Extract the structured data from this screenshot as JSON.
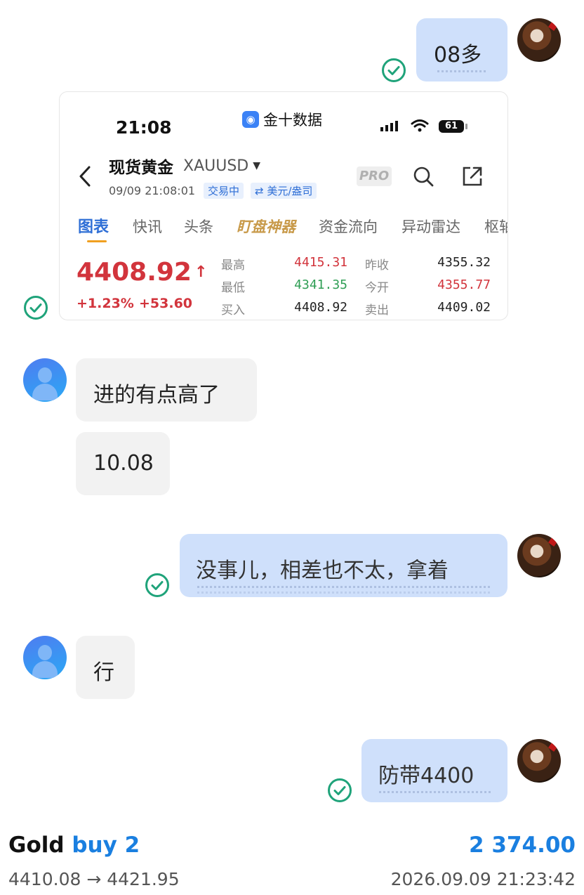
{
  "messages": {
    "m1": "08多",
    "m2": "进的有点高了",
    "m3": "10.08",
    "m4": "没事儿，相差也不太，拿着",
    "m5": "行",
    "m6": "防带4400"
  },
  "shot": {
    "time": "21:08",
    "app_name": "金十数据",
    "battery": "61",
    "instrument": "现货黄金",
    "symbol": "XAUUSD",
    "datetime": "09/09 21:08:01",
    "tag_trading": "交易中",
    "tag_currency": "⇄ 美元/盎司",
    "pro_badge": "PRO",
    "tabs": [
      "图表",
      "快讯",
      "头条",
      "盯盘神器",
      "资金流向",
      "异动雷达",
      "枢轴"
    ],
    "price": "4408.92",
    "change_pct": "+1.23%",
    "change_abs": "+53.60",
    "stats": {
      "high_label": "最高",
      "high": "4415.31",
      "low_label": "最低",
      "low": "4341.35",
      "buy_label": "买入",
      "buy": "4408.92",
      "prev_close_label": "昨收",
      "prev_close": "4355.32",
      "open_label": "今开",
      "open": "4355.77",
      "sell_label": "卖出",
      "sell": "4409.02"
    }
  },
  "footer": {
    "asset": "Gold",
    "side": "buy 2",
    "profit": "2 374.00",
    "price_range": "4410.08 → 4421.95",
    "timestamp": "2026.09.09 21:23:42"
  },
  "colors": {
    "accent_blue": "#1a7fe0",
    "self_bubble": "#cfe0fb",
    "check_green": "#1fa37a",
    "up_red": "#d2343c",
    "down_green": "#2f9e55"
  }
}
